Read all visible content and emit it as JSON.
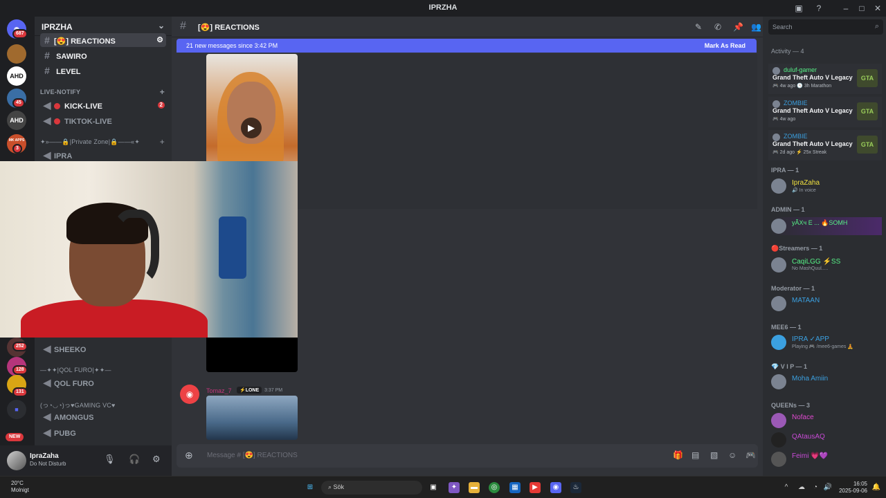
{
  "window": {
    "title": "IPRZHA"
  },
  "guilds": [
    {
      "label": "",
      "badge": "687",
      "color": "#5865f2"
    },
    {
      "label": "",
      "badge": "",
      "color": "#a06a2e"
    },
    {
      "label": "AHD",
      "badge": "",
      "color": "#2b2d31"
    },
    {
      "label": "",
      "badge": "45",
      "color": "#3a6ea5"
    },
    {
      "label": "AHD",
      "badge": "",
      "color": "#444"
    },
    {
      "label": "MK APPS",
      "badge": "3",
      "color": "#c94f2b"
    },
    {
      "label": "",
      "badge": "252",
      "color": "#553333"
    },
    {
      "label": "",
      "badge": "128",
      "color": "#b5357b"
    },
    {
      "label": "",
      "badge": "131",
      "color": "#d9a514"
    },
    {
      "label": "",
      "badge": "",
      "color": "#4e5bd8"
    },
    {
      "label": "",
      "badge": "NEW",
      "color": "#33363c"
    }
  ],
  "server": {
    "name": "IPRZHA"
  },
  "channels": {
    "reactions": "REACTIONS",
    "reactions_prefix": "[😍]",
    "sawiro": "SAWIRO",
    "level": "LEVEL",
    "cat_live": "LIVE-NOTIFY",
    "kick_live": "KICK-LIVE",
    "kick_badge": "2",
    "tiktok_live": "TIKTOK-LIVE",
    "cat_private": "✦»——🔒|Private Zone|🔒——«✦",
    "ipra": "IPRA",
    "sheeko": "SHEEKO",
    "cat_qol": "—✦✦|QOL FURO|✦✦—",
    "qol_furo": "QOL FURO",
    "cat_gaming": "(っ◔◡◔)っ♥GAMING VC♥",
    "amongus": "AMONGUS",
    "pubg": "PUBG"
  },
  "user": {
    "name": "IpraZaha",
    "status": "Do Not Disturb"
  },
  "header": {
    "channel": "REACTIONS",
    "channel_prefix": "[😍]"
  },
  "newbar": {
    "text": "21 new messages since 3:42 PM",
    "action": "Mark As Read"
  },
  "message2": {
    "author": "Tomaz_7",
    "tag": "⚡LONE",
    "time": "3:37 PM"
  },
  "composer": {
    "placeholder": "Message #  [😍]  REACTIONS"
  },
  "members": {
    "search_placeholder": "Search",
    "activity_label": "Activity — 4",
    "activities": [
      {
        "name": "duluf-gamer",
        "game": "Grand Theft Auto V Legacy",
        "time": "🎮 4w ago  🕓 3h Marathon",
        "name_color": "#57f287"
      },
      {
        "name": "ZOMBIE",
        "game": "Grand Theft Auto V Legacy",
        "time": "🎮 4w ago",
        "name_color": "#3ba0e0"
      },
      {
        "name": "ZOMBIE",
        "game": "Grand Theft Auto V Legacy",
        "time": "🎮 2d ago  ⚡ 25x Streak",
        "name_color": "#3ba0e0"
      }
    ],
    "game_abbr": "GTA",
    "groups": [
      {
        "label": "IPRA — 1",
        "members": [
          {
            "name": "IpraZaha",
            "sub": "🔊 In voice",
            "color": "#f0e040"
          }
        ]
      },
      {
        "label": "ADMIN — 1",
        "members": [
          {
            "name": "yÃXч E ...  🔥SOMH",
            "sub": "",
            "color": "#57f287"
          }
        ]
      },
      {
        "label": "🔴Streamers — 1",
        "members": [
          {
            "name": "CaqiLGG ⚡SS",
            "sub": "No MashQuul.....",
            "color": "#57f287"
          }
        ]
      },
      {
        "label": "Moderator — 1",
        "members": [
          {
            "name": "MATAAN",
            "sub": "",
            "color": "#3ba0e0"
          }
        ]
      },
      {
        "label": "MEE6 — 1",
        "members": [
          {
            "name": "IPRA ✓APP",
            "sub": "Playing 🎮 /mee6-games 🧘",
            "color": "#3ba0e0"
          }
        ]
      },
      {
        "label": "💎 V I P — 1",
        "members": [
          {
            "name": "Moha Amiin",
            "sub": "",
            "color": "#3ba0e0"
          }
        ]
      },
      {
        "label": "QUEENs — 3",
        "members": [
          {
            "name": "Noface",
            "sub": "",
            "color": "#e04ad0"
          },
          {
            "name": "QAtausAQ",
            "sub": "",
            "color": "#c84bd6"
          },
          {
            "name": "Feimi 💗💜",
            "sub": "",
            "color": "#c84bd6"
          }
        ]
      }
    ]
  },
  "taskbar": {
    "temp": "20°C",
    "weather": "Molnigt",
    "search": "Sök",
    "time": "16:05",
    "date": "2025-09-06"
  }
}
